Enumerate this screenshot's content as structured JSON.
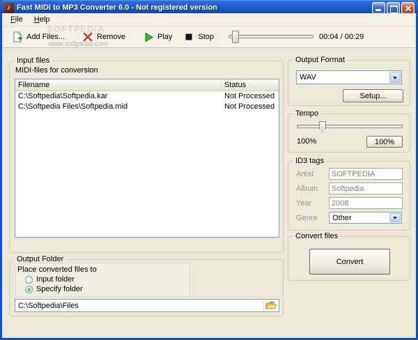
{
  "window": {
    "title": "Fast MIDI to MP3 Converter 6.0 - Not registered version",
    "watermark_large": "SOFTPEDIA",
    "watermark_small": "www.softpedia.com"
  },
  "menu": {
    "file": "File",
    "help": "Help"
  },
  "toolbar": {
    "add_files_label": "Add Files...",
    "remove_label": "Remove",
    "play_label": "Play",
    "stop_label": "Stop",
    "time": "00:04 / 00:29"
  },
  "input_files": {
    "caption": "Input files",
    "subcaption": "MIDI-files for conversion",
    "columns": {
      "filename": "Filename",
      "status": "Status"
    },
    "rows": [
      {
        "filename": "C:\\Softpedia\\Softpedia.kar",
        "status": "Not Processed"
      },
      {
        "filename": "C:\\Softpedia Files\\Softpedia.mid",
        "status": "Not Processed"
      }
    ]
  },
  "output_folder": {
    "caption": "Output Folder",
    "place_label": "Place converted files to",
    "radio_input_folder": "Input folder",
    "radio_specify_folder": "Specify folder",
    "path": "C:\\Softpedia\\Files"
  },
  "output_format": {
    "caption": "Output Format",
    "selected": "WAV",
    "setup_label": "Setup..."
  },
  "tempo": {
    "caption": "Tempo",
    "value": "100%",
    "reset_label": "100%"
  },
  "id3": {
    "caption": "ID3 tags",
    "artist_label": "Artist",
    "artist_value": "SOFTPEDIA",
    "album_label": "Album",
    "album_value": "Softpedia",
    "year_label": "Year",
    "year_value": "2008",
    "genre_label": "Genre",
    "genre_value": "Other"
  },
  "convert": {
    "caption": "Convert files",
    "button_label": "Convert"
  }
}
